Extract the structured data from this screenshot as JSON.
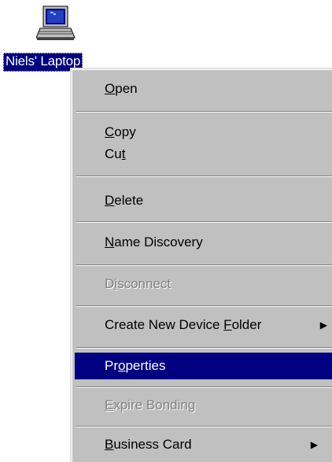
{
  "desktop_icon": {
    "label": "Niels' Laptop",
    "icon": "laptop-icon"
  },
  "menu": {
    "items": [
      {
        "id": "open",
        "pre": "",
        "mnemonic": "O",
        "post": "pen",
        "enabled": true
      },
      {
        "id": "copy",
        "pre": "",
        "mnemonic": "C",
        "post": "opy",
        "enabled": true
      },
      {
        "id": "cut",
        "pre": "Cu",
        "mnemonic": "t",
        "post": "",
        "enabled": true
      },
      {
        "id": "delete",
        "pre": "",
        "mnemonic": "D",
        "post": "elete",
        "enabled": true
      },
      {
        "id": "name-discovery",
        "pre": "",
        "mnemonic": "N",
        "post": "ame Discovery",
        "enabled": true
      },
      {
        "id": "disconnect",
        "pre": "D",
        "mnemonic": "i",
        "post": "sconnect",
        "enabled": false
      },
      {
        "id": "create-new-device-folder",
        "pre": "Create New Device ",
        "mnemonic": "F",
        "post": "older",
        "enabled": true,
        "submenu": true
      },
      {
        "id": "properties",
        "pre": "Pr",
        "mnemonic": "o",
        "post": "perties",
        "enabled": true,
        "selected": true
      },
      {
        "id": "expire-bonding",
        "pre": "",
        "mnemonic": "E",
        "post": "xpire Bonding",
        "enabled": false
      },
      {
        "id": "business-card",
        "pre": "",
        "mnemonic": "B",
        "post": "usiness Card",
        "enabled": true,
        "submenu": true
      }
    ],
    "submenu_arrow": "▶"
  },
  "colors": {
    "menu_bg": "#c0c0c0",
    "highlight": "#000080",
    "disabled_text": "#808080"
  }
}
